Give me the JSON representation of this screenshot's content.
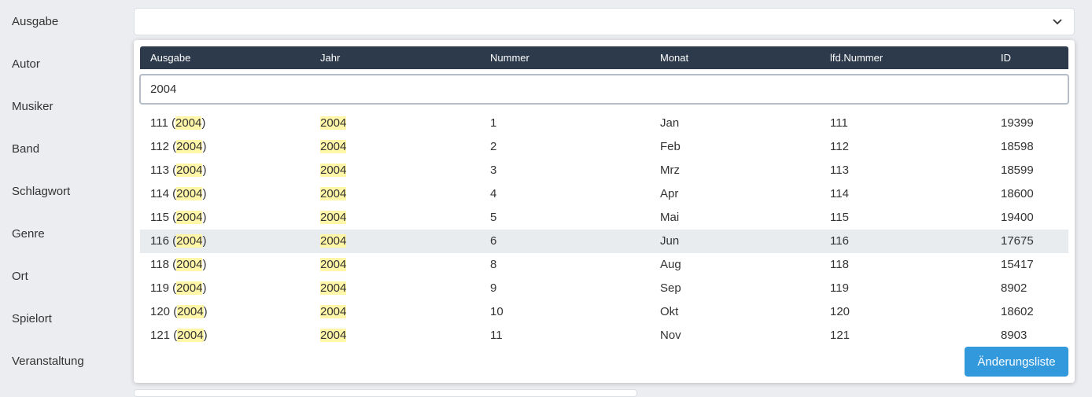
{
  "fields": [
    "Ausgabe",
    "Autor",
    "Musiker",
    "Band",
    "Schlagwort",
    "Genre",
    "Ort",
    "Spielort",
    "Veranstaltung"
  ],
  "dropdown": {
    "columns": [
      "Ausgabe",
      "Jahr",
      "Nummer",
      "Monat",
      "lfd.Nummer",
      "ID"
    ],
    "search_value": "2004",
    "highlight_term": "2004",
    "rows": [
      {
        "ausgabe_num": "111",
        "jahr": "2004",
        "nummer": "1",
        "monat": "Jan",
        "lfd": "111",
        "id": "19399"
      },
      {
        "ausgabe_num": "112",
        "jahr": "2004",
        "nummer": "2",
        "monat": "Feb",
        "lfd": "112",
        "id": "18598"
      },
      {
        "ausgabe_num": "113",
        "jahr": "2004",
        "nummer": "3",
        "monat": "Mrz",
        "lfd": "113",
        "id": "18599"
      },
      {
        "ausgabe_num": "114",
        "jahr": "2004",
        "nummer": "4",
        "monat": "Apr",
        "lfd": "114",
        "id": "18600"
      },
      {
        "ausgabe_num": "115",
        "jahr": "2004",
        "nummer": "5",
        "monat": "Mai",
        "lfd": "115",
        "id": "19400"
      },
      {
        "ausgabe_num": "116",
        "jahr": "2004",
        "nummer": "6",
        "monat": "Jun",
        "lfd": "116",
        "id": "17675",
        "highlighted": true
      },
      {
        "ausgabe_num": "118",
        "jahr": "2004",
        "nummer": "8",
        "monat": "Aug",
        "lfd": "118",
        "id": "15417"
      },
      {
        "ausgabe_num": "119",
        "jahr": "2004",
        "nummer": "9",
        "monat": "Sep",
        "lfd": "119",
        "id": "8902"
      },
      {
        "ausgabe_num": "120",
        "jahr": "2004",
        "nummer": "10",
        "monat": "Okt",
        "lfd": "120",
        "id": "18602"
      },
      {
        "ausgabe_num": "121",
        "jahr": "2004",
        "nummer": "11",
        "monat": "Nov",
        "lfd": "121",
        "id": "8903"
      }
    ],
    "button_label": "Änderungsliste"
  },
  "icons": {
    "select_toggle": "chevron-down-icon"
  },
  "colors": {
    "header_bg": "#2c3a4b",
    "button_bg": "#3399dd",
    "mark_bg": "#fff6a8",
    "row_highlight": "#e9ecef"
  }
}
